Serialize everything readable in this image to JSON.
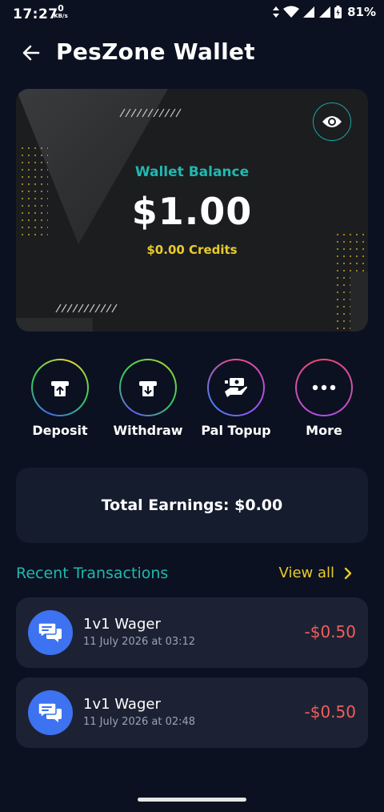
{
  "status_bar": {
    "time": "17:27",
    "net_speed_value": "0",
    "net_speed_unit": "KB/s",
    "battery": "81%"
  },
  "header": {
    "title": "PesZone Wallet"
  },
  "card": {
    "label": "Wallet Balance",
    "balance": "$1.00",
    "credits": "$0.00 Credits",
    "eye_icon": "eye-icon"
  },
  "actions": [
    {
      "label": "Deposit",
      "icon": "deposit-icon"
    },
    {
      "label": "Withdraw",
      "icon": "withdraw-icon"
    },
    {
      "label": "Pal Topup",
      "icon": "money-transfer-icon"
    },
    {
      "label": "More",
      "icon": "more-dots-icon"
    }
  ],
  "earnings": {
    "text": "Total Earnings: $0.00"
  },
  "recent": {
    "title": "Recent Transactions",
    "view_all": "View all",
    "transactions": [
      {
        "title": "1v1 Wager",
        "date": "11 July 2026 at 03:12",
        "amount": "-$0.50",
        "icon": "chat-bubbles-icon"
      },
      {
        "title": "1v1 Wager",
        "date": "11 July 2026 at 02:48",
        "amount": "-$0.50",
        "icon": "chat-bubbles-icon"
      }
    ]
  },
  "colors": {
    "background": "#0b1120",
    "accent_teal": "#20b8b0",
    "accent_yellow": "#e8cb2c",
    "negative_red": "#ef5e5e",
    "avatar_blue": "#3d72f0"
  }
}
